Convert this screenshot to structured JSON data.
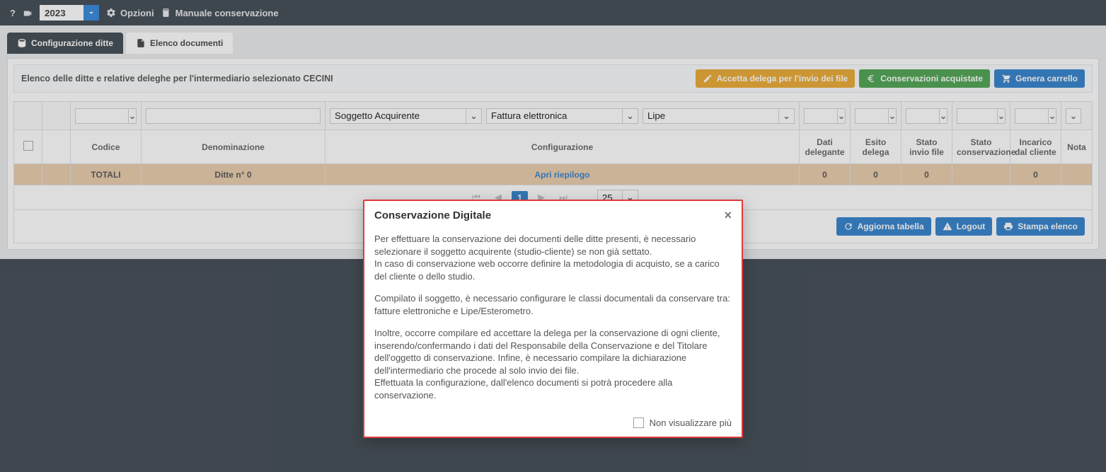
{
  "topbar": {
    "year": "2023",
    "opzioni": "Opzioni",
    "manuale": "Manuale conservazione"
  },
  "tabs": {
    "config": "Configurazione ditte",
    "elenco": "Elenco documenti"
  },
  "panel": {
    "title": "Elenco delle ditte e relative deleghe per l'intermediario selezionato CECINI",
    "btn_accetta": "Accetta delega per l'invio dei file",
    "btn_conserv": "Conservazioni acquistate",
    "btn_cart": "Genera carrello"
  },
  "filters": {
    "soggetto": "Soggetto Acquirente",
    "fattura": "Fattura elettronica",
    "lipe": "Lipe"
  },
  "headers": {
    "codice": "Codice",
    "denom": "Denominazione",
    "config": "Configurazione",
    "dati_delegante": "Dati delegante",
    "esito_delega": "Esito delega",
    "stato_invio": "Stato invio file",
    "stato_cons": "Stato conservazione",
    "incarico": "Incarico dal cliente",
    "nota": "Nota"
  },
  "totals": {
    "label": "TOTALI",
    "ditte": "Ditte n° 0",
    "riepilogo": "Apri riepilogo",
    "v1": "0",
    "v2": "0",
    "v3": "0",
    "v5": "0"
  },
  "pager": {
    "page": "1",
    "size": "25"
  },
  "footer": {
    "aggiorna": "Aggiorna tabella",
    "logout": "Logout",
    "stampa": "Stampa elenco"
  },
  "modal": {
    "title": "Conservazione Digitale",
    "p1": "Per effettuare la conservazione dei documenti delle ditte presenti, è necessario selezionare il soggetto acquirente (studio-cliente) se non già settato.",
    "p1b": "In caso di conservazione web occorre definire la metodologia di acquisto, se a carico del cliente o dello studio.",
    "p2": "Compilato il soggetto, è necessario configurare le classi documentali da conservare tra: fatture elettroniche e Lipe/Esterometro.",
    "p3": "Inoltre, occorre compilare ed accettare la delega per la conservazione di ogni cliente, inserendo/confermando i dati del Responsabile della Conservazione e del Titolare dell'oggetto di conservazione. Infine, è necessario compilare la dichiarazione dell'intermediario che procede al solo invio dei file.",
    "p3b": "Effettuata la configurazione, dall'elenco documenti si potrà procedere alla conservazione.",
    "dont_show": "Non visualizzare più"
  }
}
